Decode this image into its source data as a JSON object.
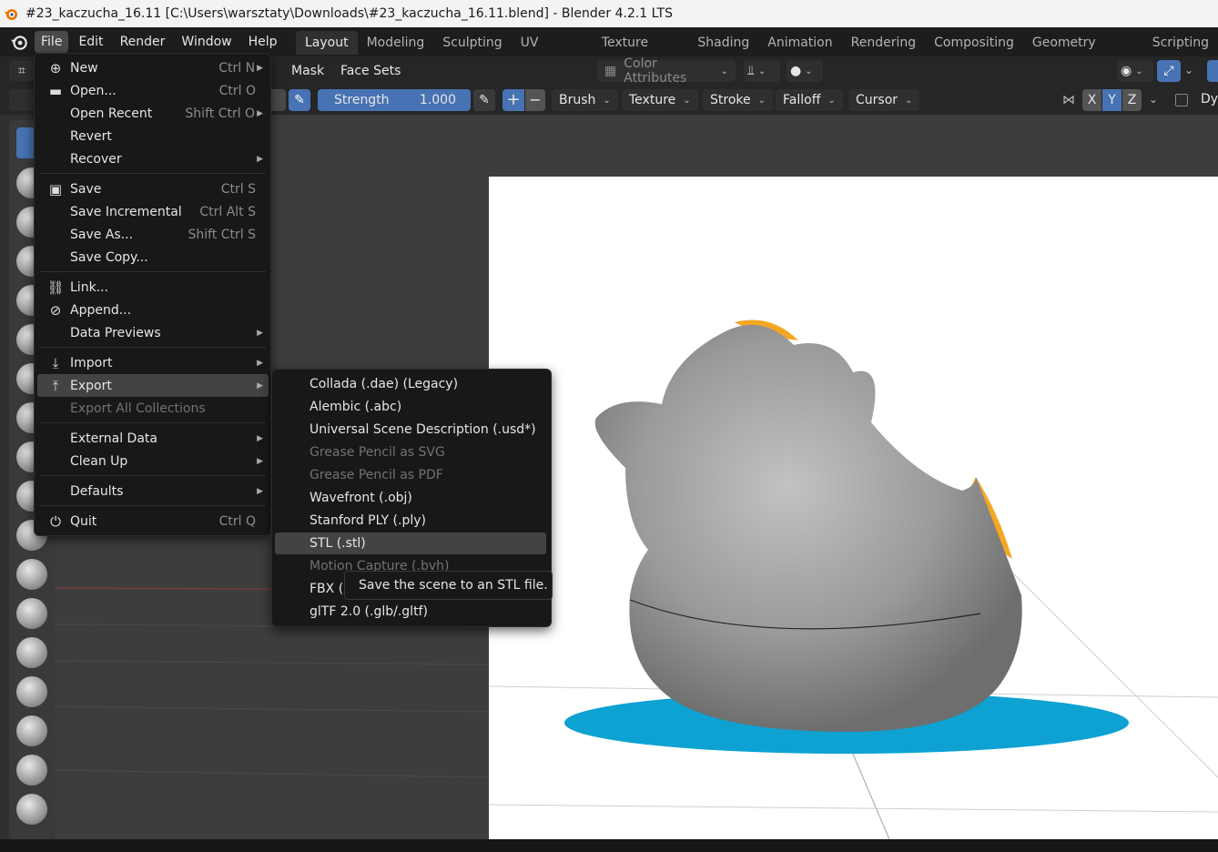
{
  "titlebar": {
    "title": "#23_kaczucha_16.11 [C:\\Users\\warsztaty\\Downloads\\#23_kaczucha_16.11.blend] - Blender 4.2.1 LTS"
  },
  "menubar": {
    "items": [
      "File",
      "Edit",
      "Render",
      "Window",
      "Help"
    ],
    "tabs": [
      "Layout",
      "Modeling",
      "Sculpting",
      "UV Editing",
      "Texture Paint",
      "Shading",
      "Animation",
      "Rendering",
      "Compositing",
      "Geometry Nodes",
      "Scripting"
    ]
  },
  "header1": {
    "mask": "Mask",
    "face_sets": "Face Sets",
    "color_attributes": "Color Attributes"
  },
  "header2": {
    "strength_label": "Strength",
    "strength_value": "1.000",
    "plus": "+",
    "minus": "−",
    "brush": "Brush",
    "texture": "Texture",
    "stroke": "Stroke",
    "falloff": "Falloff",
    "cursor": "Cursor",
    "x": "X",
    "y": "Y",
    "z": "Z",
    "dy": "Dy"
  },
  "file_menu": [
    {
      "label": "New",
      "shortcut": "Ctrl N",
      "icon": "new-file-icon",
      "submenu": true
    },
    {
      "label": "Open...",
      "shortcut": "Ctrl O",
      "icon": "folder-icon"
    },
    {
      "label": "Open Recent",
      "shortcut": "Shift Ctrl O",
      "submenu": true
    },
    {
      "label": "Revert",
      "shortcut": ""
    },
    {
      "label": "Recover",
      "shortcut": "",
      "submenu": true
    },
    {
      "label": "Save",
      "shortcut": "Ctrl S",
      "icon": "save-icon"
    },
    {
      "label": "Save Incremental",
      "shortcut": "Ctrl Alt S"
    },
    {
      "label": "Save As...",
      "shortcut": "Shift Ctrl S"
    },
    {
      "label": "Save Copy...",
      "shortcut": ""
    },
    {
      "label": "Link...",
      "shortcut": "",
      "icon": "link-icon"
    },
    {
      "label": "Append...",
      "shortcut": "",
      "icon": "append-icon"
    },
    {
      "label": "Data Previews",
      "shortcut": "",
      "submenu": true
    },
    {
      "label": "Import",
      "shortcut": "",
      "icon": "import-icon",
      "submenu": true
    },
    {
      "label": "Export",
      "shortcut": "",
      "icon": "export-icon",
      "submenu": true,
      "highlighted": true
    },
    {
      "label": "Export All Collections",
      "shortcut": "",
      "disabled": true
    },
    {
      "label": "External Data",
      "shortcut": "",
      "submenu": true
    },
    {
      "label": "Clean Up",
      "shortcut": "",
      "submenu": true
    },
    {
      "label": "Defaults",
      "shortcut": "",
      "submenu": true
    },
    {
      "label": "Quit",
      "shortcut": "Ctrl Q",
      "icon": "power-icon"
    }
  ],
  "export_menu": [
    {
      "label": "Collada (.dae) (Legacy)"
    },
    {
      "label": "Alembic (.abc)"
    },
    {
      "label": "Universal Scene Description (.usd*)"
    },
    {
      "label": "Grease Pencil as SVG",
      "disabled": true
    },
    {
      "label": "Grease Pencil as PDF",
      "disabled": true
    },
    {
      "label": "Wavefront (.obj)"
    },
    {
      "label": "Stanford PLY (.ply)"
    },
    {
      "label": "STL (.stl)",
      "highlighted": true
    },
    {
      "label": "Motion Capture (.bvh)",
      "disabled": true
    },
    {
      "label": "FBX (.fbx)"
    },
    {
      "label": "glTF 2.0 (.glb/.gltf)"
    }
  ],
  "tooltip": {
    "text": "Save the scene to an STL file."
  },
  "colors": {
    "accent": "#4772b3",
    "duck_accent": "#f5a623",
    "base_ring": "#0da2d2"
  }
}
